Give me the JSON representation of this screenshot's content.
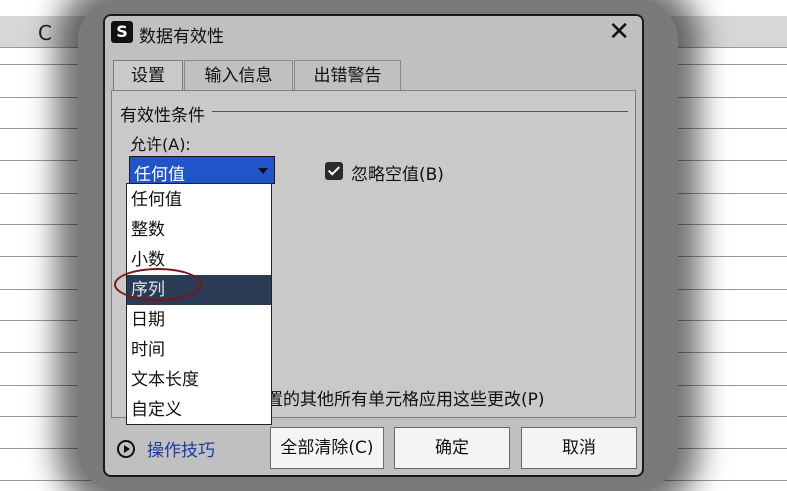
{
  "sheet": {
    "column_letter": "C"
  },
  "dialog": {
    "title": "数据有效性",
    "app_icon": "S",
    "close": "✕",
    "tabs": [
      "设置",
      "输入信息",
      "出错警告"
    ],
    "group_title": "有效性条件",
    "allow_label": "允许(A):",
    "allow_selected": "任何值",
    "ignore_blank_label": "忽略空值(B)",
    "ignore_blank_checked": true,
    "apply_text": "置的其他所有单元格应用这些更改(P)",
    "dropdown_options": [
      "任何值",
      "整数",
      "小数",
      "序列",
      "日期",
      "时间",
      "文本长度",
      "自定义"
    ],
    "highlighted_option": "序列",
    "tips_label": "操作技巧",
    "buttons": {
      "clear_all": "全部清除(C)",
      "ok": "确定",
      "cancel": "取消"
    }
  },
  "colors": {
    "selection_blue": "#1f55c8",
    "highlight_dark": "#2c3b55",
    "annotation_red": "#7a1515",
    "tips_blue": "#1a3aa6"
  }
}
